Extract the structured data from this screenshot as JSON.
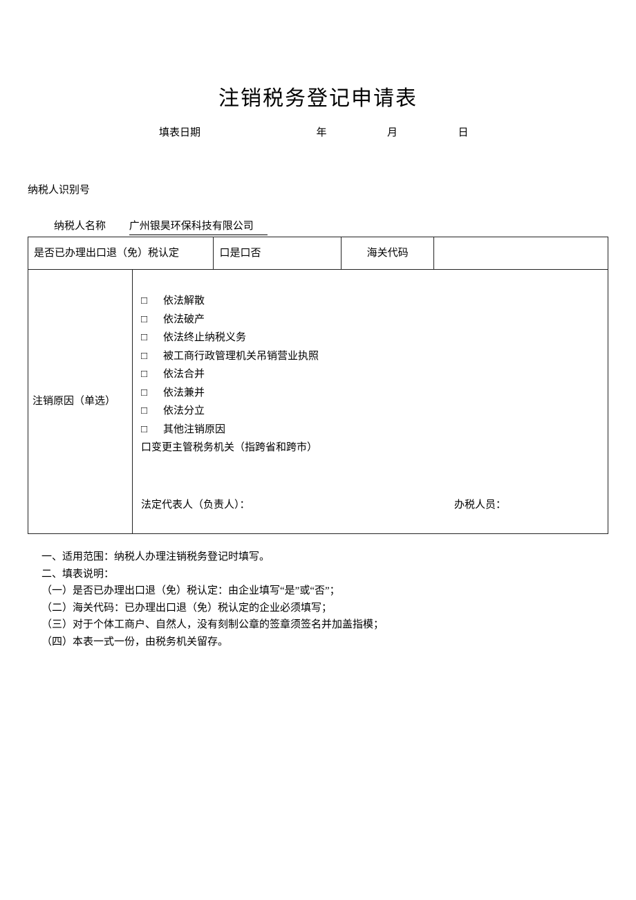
{
  "title": "注销税务登记申请表",
  "dateRow": {
    "label": "填表日期",
    "year": "年",
    "month": "月",
    "day": "日"
  },
  "taxpayerId": {
    "label": "纳税人识别号",
    "value": ""
  },
  "taxpayerName": {
    "label": "纳税人名称",
    "value": "广州银昊环保科技有限公司"
  },
  "row1": {
    "exemptLabel": "是否已办理出口退（免）税认定",
    "exemptValue": "口是口否",
    "customsLabel": "海关代码",
    "customsValue": ""
  },
  "reasonSection": {
    "label": "注销原因（单选）",
    "reasons": [
      "依法解散",
      "依法破产",
      "依法终止纳税义务",
      "被工商行政管理机关吊销营业执照",
      "依法合并",
      "依法兼并",
      "依法分立",
      "其他注销原因"
    ],
    "extra": "口变更主管税务机关（指跨省和跨市）",
    "sigLeft": "法定代表人（负责人）：",
    "sigRight": "办税人员："
  },
  "notes": [
    "一、适用范围：纳税人办理注销税务登记时填写。",
    "二、填表说明：",
    "（一）是否已办理出口退（免）税认定：由企业填写“是”或“否”；",
    "（二）海关代码：已办理出口退（免）税认定的企业必须填写；",
    "（三）对于个体工商户、自然人，没有刻制公章的签章须签名并加盖指模；",
    "（四）本表一式一份，由税务机关留存。"
  ],
  "checkboxGlyph": "□"
}
